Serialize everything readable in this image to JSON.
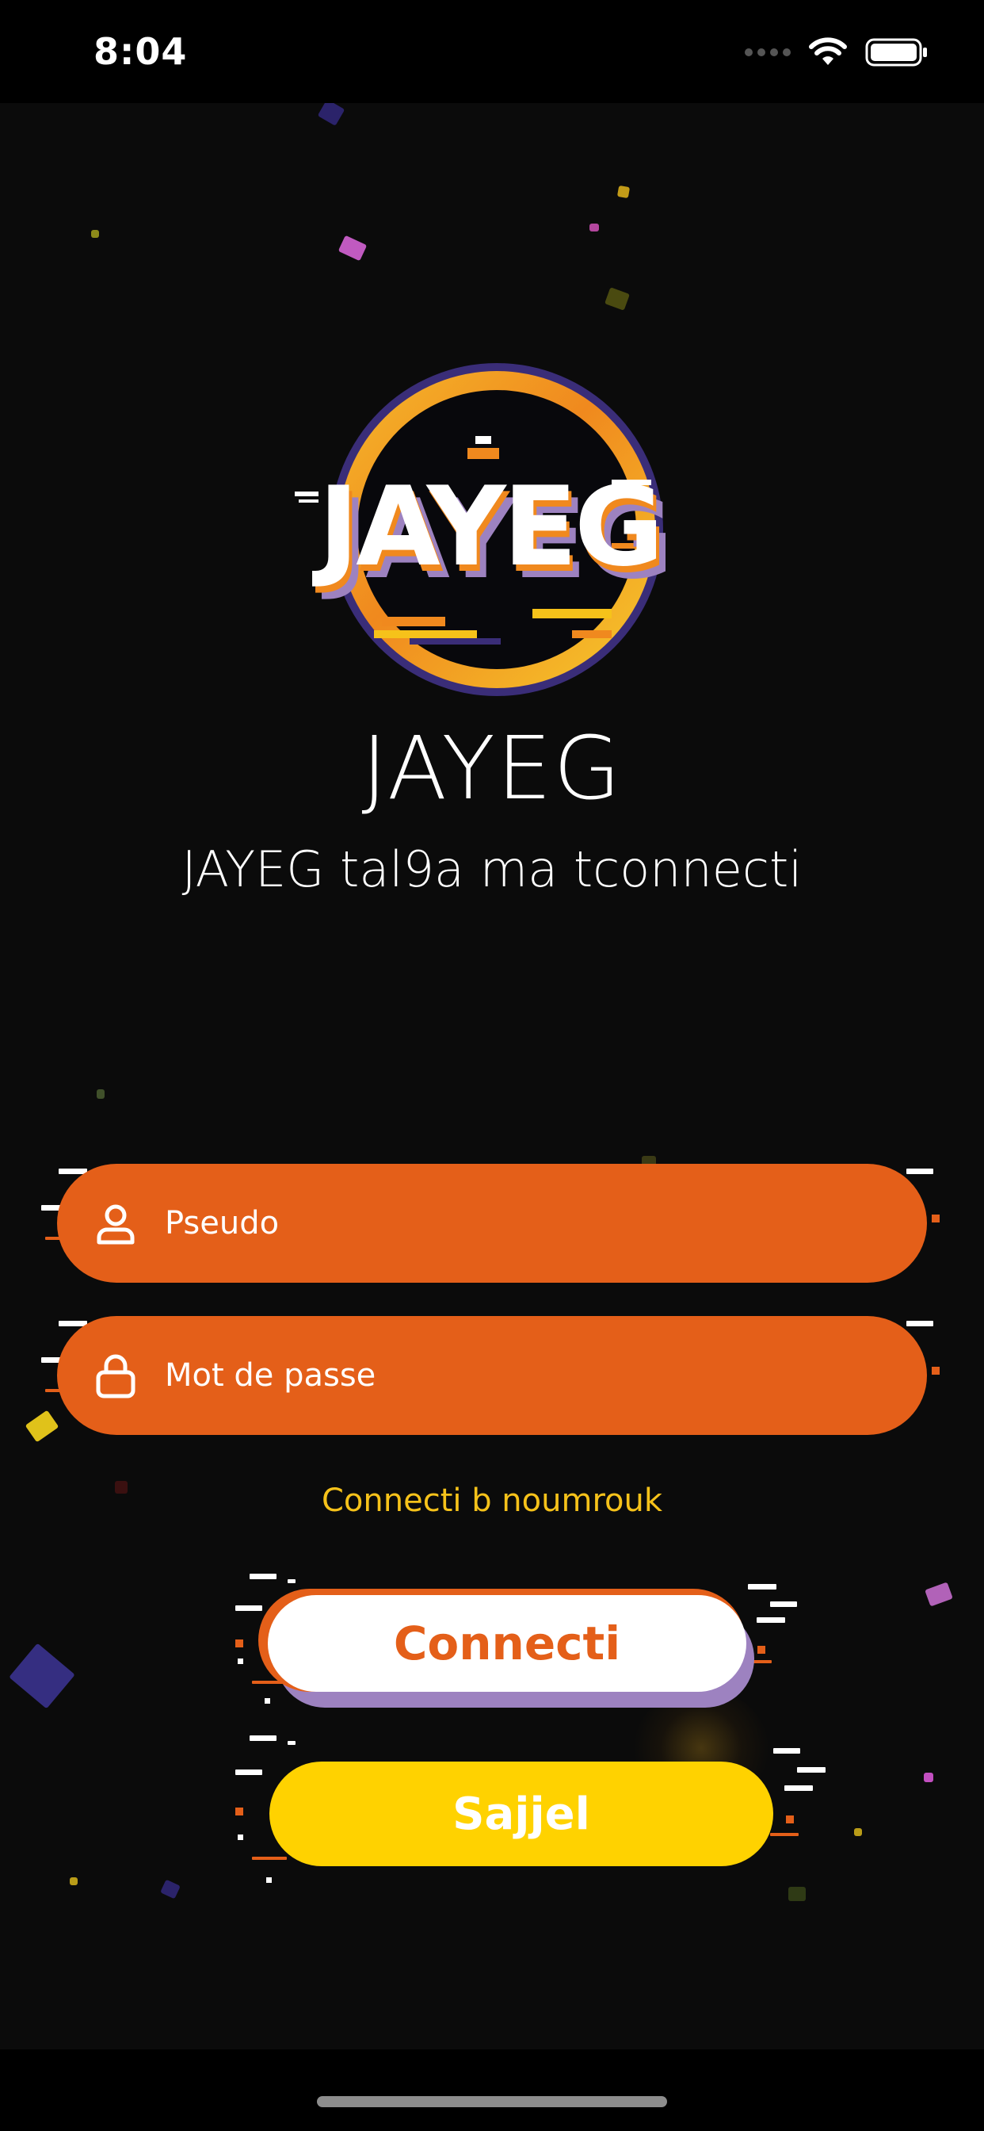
{
  "status_bar": {
    "time": "8:04"
  },
  "app": {
    "logo_text": "JAYEG",
    "title": "JAYEG",
    "tagline": "JAYEG tal9a ma tconnecti"
  },
  "form": {
    "username_placeholder": "Pseudo",
    "password_placeholder": "Mot de passe",
    "phone_link": "Connecti b noumrouk"
  },
  "buttons": {
    "login": "Connecti",
    "register": "Sajjel"
  },
  "icons": {
    "username": "user-icon",
    "password": "lock-icon",
    "wifi": "wifi-icon",
    "battery": "battery-icon"
  },
  "colors": {
    "orange": "#e45f19",
    "yellow": "#ffd200",
    "purple": "#9d82c0",
    "link": "#f6c21a"
  }
}
